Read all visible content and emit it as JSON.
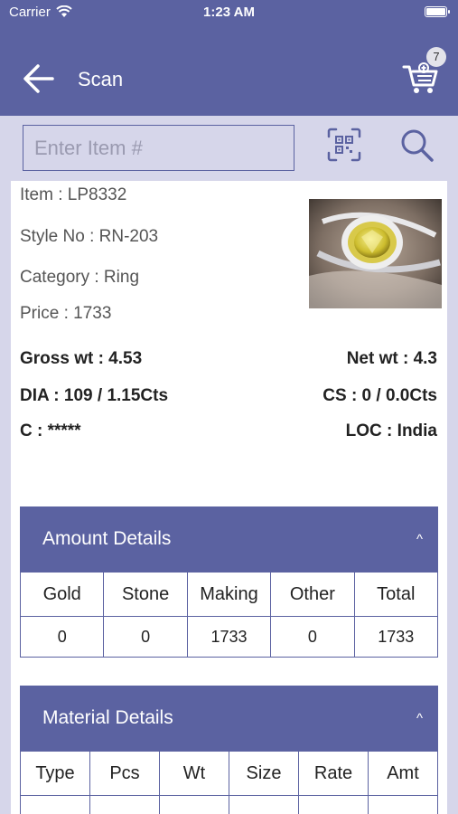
{
  "status_bar": {
    "carrier": "Carrier",
    "time": "1:23 AM"
  },
  "header": {
    "title": "Scan",
    "cart_count": "7"
  },
  "search": {
    "placeholder": "Enter Item #"
  },
  "item": {
    "item": "Item : LP8332",
    "style_no": "Style No : RN-203",
    "category": "Category : Ring",
    "price": "Price : 1733",
    "gross_wt": "Gross wt : 4.53",
    "net_wt": "Net wt : 4.3",
    "dia": "DIA : 109 / 1.15Cts",
    "cs": "CS : 0 / 0.0Cts",
    "c": "C : *****",
    "loc": "LOC : India"
  },
  "amount_details": {
    "title": "Amount Details",
    "chevron": "^",
    "headers": [
      "Gold",
      "Stone",
      "Making",
      "Other",
      "Total"
    ],
    "values": [
      "0",
      "0",
      "1733",
      "0",
      "1733"
    ]
  },
  "material_details": {
    "title": "Material Details",
    "chevron": "^",
    "headers": [
      "Type",
      "Pcs",
      "Wt",
      "Size",
      "Rate",
      "Amt"
    ]
  },
  "colors": {
    "primary": "#5b62a1",
    "background": "#d6d6ea",
    "card": "#ffffff"
  },
  "icons": [
    "wifi-icon",
    "battery-icon",
    "back-arrow-icon",
    "cart-icon",
    "qr-scan-icon",
    "search-icon"
  ]
}
